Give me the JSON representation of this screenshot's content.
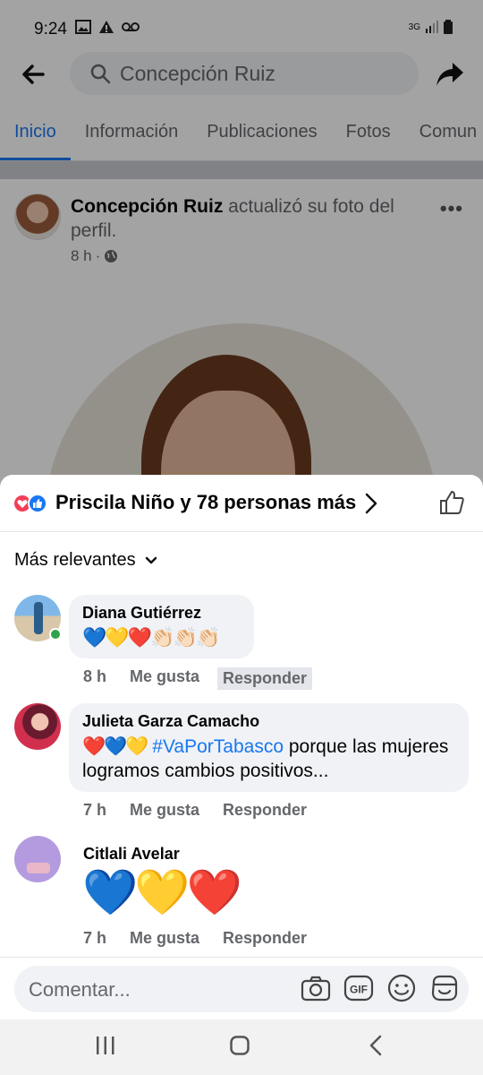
{
  "status_bar": {
    "time": "9:24",
    "network": "3G"
  },
  "header": {
    "search_text": "Concepción Ruiz"
  },
  "tabs": [
    {
      "label": "Inicio"
    },
    {
      "label": "Información"
    },
    {
      "label": "Publicaciones"
    },
    {
      "label": "Fotos"
    },
    {
      "label": "Comun"
    }
  ],
  "post": {
    "author": "Concepción Ruiz",
    "action_text": " actualizó su foto del perfil.",
    "time": "8 h"
  },
  "reactions": {
    "summary": "Priscila Niño y 78 personas más"
  },
  "sort": {
    "label": "Más relevantes"
  },
  "comments": [
    {
      "name": "Diana Gutiérrez",
      "text": "💙💛❤️👏🏻👏🏻👏🏻",
      "time": "8 h",
      "like": "Me gusta",
      "reply": "Responder"
    },
    {
      "name": "Julieta Garza Camacho",
      "emoji": "❤️💙💛",
      "hashtag": "#VaPorTabasco",
      "text_after": " porque las mujeres logramos cambios positivos...",
      "time": "7 h",
      "like": "Me gusta",
      "reply": "Responder"
    },
    {
      "name": "Citlali Avelar",
      "text": "💙💛❤️",
      "time": "7 h",
      "like": "Me gusta",
      "reply": "Responder"
    }
  ],
  "composer": {
    "placeholder": "Comentar..."
  },
  "colors": {
    "accent": "#1877f2",
    "online": "#31a24c",
    "love": "#f33e58"
  }
}
